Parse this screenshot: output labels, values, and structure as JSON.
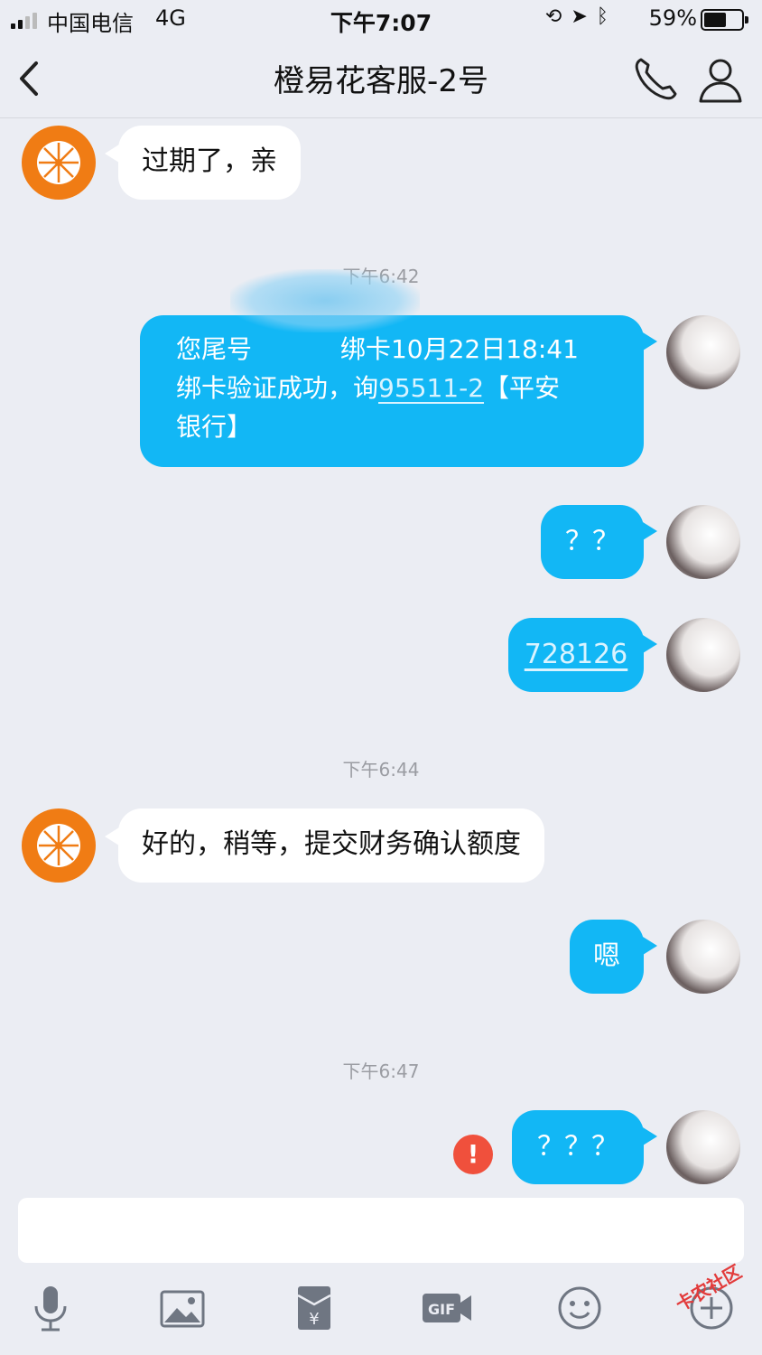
{
  "status_bar": {
    "carrier": "中国电信",
    "network": "4G",
    "time": "下午7:07",
    "battery": "59%",
    "battery_level": 0.59,
    "status_icons": [
      "orientation-lock-icon",
      "location-icon",
      "bluetooth-icon"
    ]
  },
  "header": {
    "title": "橙易花客服-2号",
    "icons": [
      "back-chevron-icon",
      "phone-icon",
      "person-icon"
    ]
  },
  "messages": [
    {
      "side": "left",
      "text": "过期了，亲"
    },
    {
      "timestamp": "下午6:42"
    },
    {
      "side": "right",
      "lines": [
        "您尾号",
        "绑卡",
        "10月22日18:41"
      ],
      "line2": "绑卡验证成功，询",
      "link": "95511-2",
      "line2_tail": "【平安",
      "line3": "银行】"
    },
    {
      "side": "right",
      "text": "？？"
    },
    {
      "side": "right",
      "text": "728126"
    },
    {
      "timestamp": "下午6:44"
    },
    {
      "side": "left",
      "text": "好的，稍等，提交财务确认额度"
    },
    {
      "side": "right",
      "text": "嗯"
    },
    {
      "timestamp": "下午6:47"
    },
    {
      "side": "right",
      "text": "？？？",
      "error": "!"
    }
  ],
  "toolbar": {
    "icons": [
      "microphone-icon",
      "image-icon",
      "red-packet-icon",
      "gif-icon",
      "emoji-icon",
      "plus-icon"
    ]
  },
  "watermark": "卡农社区",
  "colors": {
    "background": "#ebedf3",
    "bubble_right": "#12b7f5",
    "bubble_left": "#ffffff",
    "brand_avatar": "#f07c14",
    "error": "#f0503c"
  }
}
